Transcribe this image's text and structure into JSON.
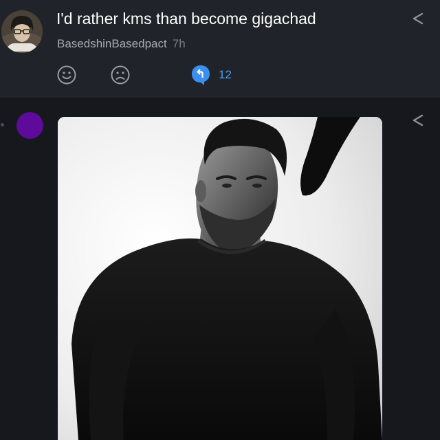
{
  "post": {
    "title": "I'd rather kms than become gigachad",
    "author": "BasedshinBasedpact",
    "time": "7h",
    "reply_count": "12"
  },
  "icons": {
    "share": "share-icon",
    "happy": "smile-face-icon",
    "sad": "frown-face-icon",
    "reply": "reply-icon"
  },
  "colors": {
    "background": "#16181e",
    "card": "#21232a",
    "accent": "#4e9cf4",
    "comment_avatar": "#5e0a9a"
  }
}
